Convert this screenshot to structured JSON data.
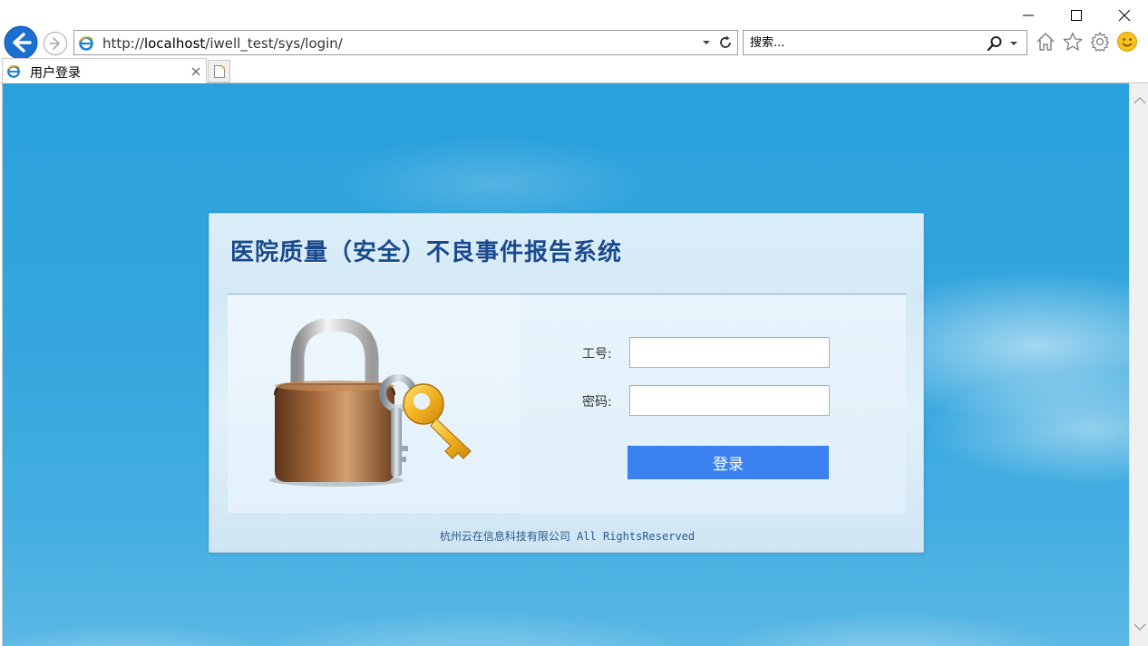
{
  "browser": {
    "address_url_prefix": "http://",
    "address_url_host": "localhost",
    "address_url_path": "/iwell_test/sys/login/",
    "search_placeholder": "搜索...",
    "tab_title": "用户登录"
  },
  "login": {
    "title": "医院质量（安全）不良事件报告系统",
    "employee_id_label": "工号:",
    "employee_id_value": "",
    "password_label": "密码:",
    "password_value": "",
    "submit_label": "登录",
    "footer_text": "杭州云在信息科技有限公司 All RightsReserved"
  },
  "colors": {
    "title": "#1a4a8e",
    "button": "#3b82f0",
    "background": "#2aa1dc"
  },
  "icons": [
    "back-arrow-icon",
    "forward-arrow-icon",
    "ie-logo-icon",
    "dropdown-caret-icon",
    "refresh-icon",
    "search-icon",
    "home-icon",
    "favorites-star-icon",
    "settings-gear-icon",
    "smiley-feedback-icon",
    "close-icon",
    "new-tab-icon",
    "minimize-icon",
    "maximize-icon",
    "window-close-icon",
    "lock-and-keys-illustration"
  ]
}
